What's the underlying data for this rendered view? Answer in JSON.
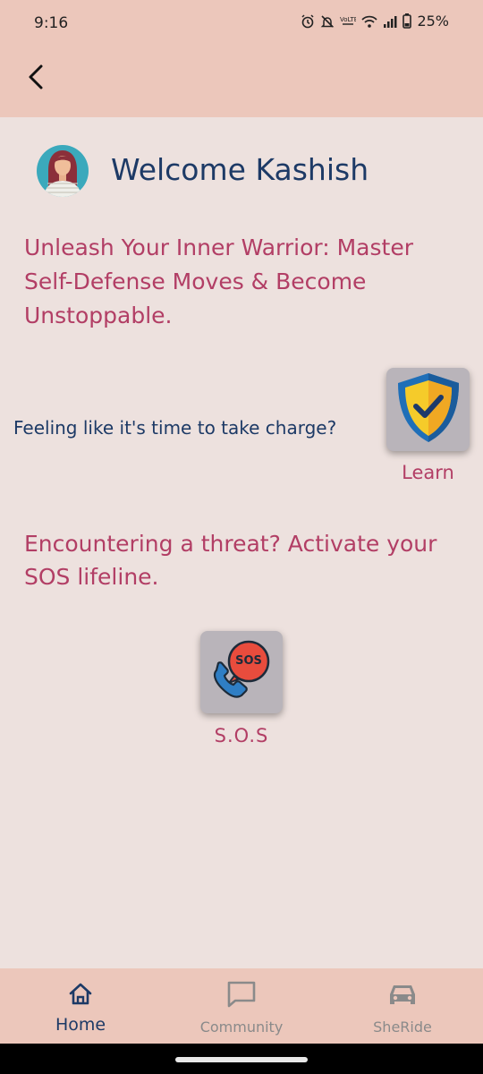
{
  "status_bar": {
    "time": "9:16",
    "battery": "25%"
  },
  "header": {
    "welcome": "Welcome Kashish"
  },
  "main": {
    "headline": "Unleash Your Inner Warrior: Master Self-Defense Moves & Become Unstoppable.",
    "learn_question": "Feeling like it's time to take charge?",
    "learn_label": "Learn",
    "sos_headline": "Encountering a threat? Activate your SOS lifeline.",
    "sos_badge": "SOS",
    "sos_label": "S.O.S"
  },
  "bottom_nav": {
    "items": [
      {
        "label": "Home",
        "icon": "home-icon",
        "active": true
      },
      {
        "label": "Community",
        "icon": "chat-bubble-icon",
        "active": false
      },
      {
        "label": "SheRide",
        "icon": "car-icon",
        "active": false
      }
    ]
  },
  "colors": {
    "header_bg": "#ECC7BB",
    "page_bg": "#EDE1DE",
    "navy": "#1D3A66",
    "rose": "#B23E65",
    "tile_bg": "#B9B4BA"
  }
}
